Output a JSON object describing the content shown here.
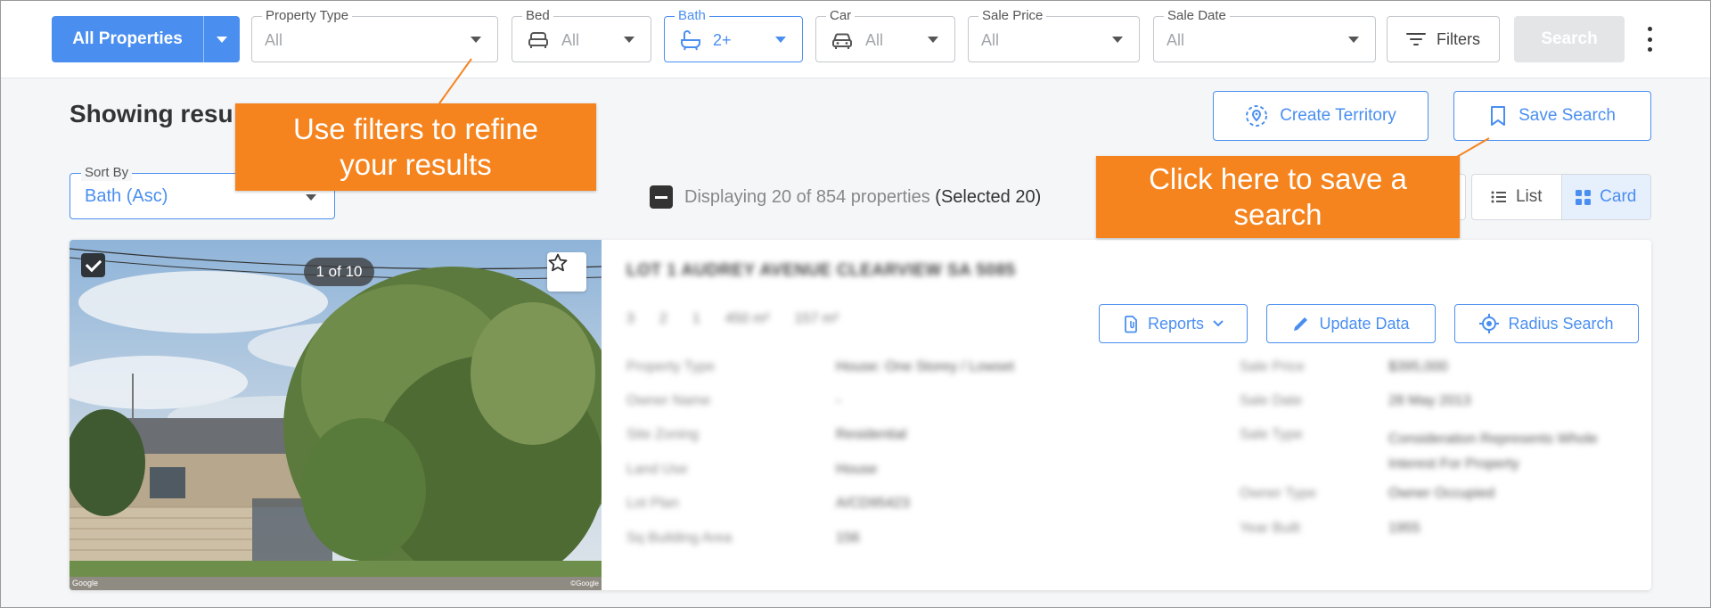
{
  "topbar": {
    "all_properties": "All Properties",
    "filters": [
      {
        "label": "Property Type",
        "value": "All"
      },
      {
        "label": "Bed",
        "value": "All"
      },
      {
        "label": "Bath",
        "value": "2+"
      },
      {
        "label": "Car",
        "value": "All"
      },
      {
        "label": "Sale Price",
        "value": "All"
      },
      {
        "label": "Sale Date",
        "value": "All"
      }
    ],
    "filters_button": "Filters",
    "search_button": "Search"
  },
  "results": {
    "heading": "Showing resu",
    "create_territory": "Create Territory",
    "save_search": "Save Search",
    "sort_label": "Sort By",
    "sort_value": "Bath (Asc)",
    "displaying": "Displaying 20 of 854 properties",
    "selected": "(Selected 20)",
    "view_list": "List",
    "view_card": "Card"
  },
  "card": {
    "photo_counter": "1 of 10",
    "address": "LOT 1 AUDREY AVENUE CLEARVIEW SA 5085",
    "stats": [
      "3",
      "2",
      "1",
      "450 m²",
      "157 m²"
    ],
    "reports": "Reports",
    "update_data": "Update Data",
    "radius_search": "Radius Search",
    "details_left": [
      {
        "label": "Property Type",
        "value": "House: One Storey / Lowset"
      },
      {
        "label": "Owner Name",
        "value": "-"
      },
      {
        "label": "Site Zoning",
        "value": "Residential"
      },
      {
        "label": "Land Use",
        "value": "House"
      },
      {
        "label": "Lot Plan",
        "value": "A/CD95423"
      },
      {
        "label": "Sq Building Area",
        "value": "156"
      }
    ],
    "details_right": [
      {
        "label": "Sale Price",
        "value": "$395,000"
      },
      {
        "label": "Sale Date",
        "value": "28 May 2013"
      },
      {
        "label": "Sale Type",
        "value": "Consideration Represents Whole Interest For Property"
      },
      {
        "label": "Owner Type",
        "value": "Owner Occupied"
      },
      {
        "label": "Year Built",
        "value": "1955"
      }
    ],
    "watermark_left": "Google",
    "watermark_right": "©Google"
  },
  "tooltips": {
    "filters_tip_line1": "Use filters to refine",
    "filters_tip_line2": "your results",
    "save_tip_line1": "Click here to save a",
    "save_tip_line2": "search"
  },
  "colors": {
    "accent": "#4a8ff0",
    "tooltip": "#f5841f",
    "background": "#f5f6f8"
  }
}
